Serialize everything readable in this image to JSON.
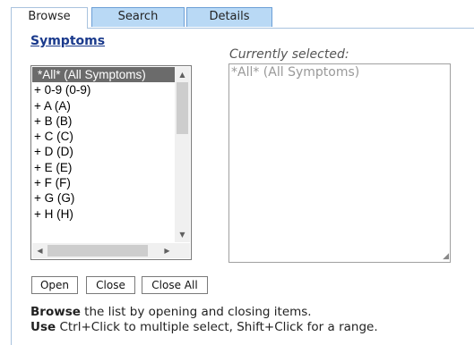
{
  "tabs": [
    {
      "label": "Browse"
    },
    {
      "label": "Search"
    },
    {
      "label": "Details"
    }
  ],
  "symptoms_link": "Symptoms",
  "list": {
    "items": [
      "*All*  (All Symptoms)",
      "+ 0-9  (0-9)",
      "+ A  (A)",
      "+ B  (B)",
      "+ C  (C)",
      "+ D  (D)",
      "+ E  (E)",
      "+ F  (F)",
      "+ G  (G)",
      "+ H  (H)"
    ]
  },
  "selected": {
    "label": "Currently selected:",
    "value": "*All* (All Symptoms)"
  },
  "buttons": {
    "open": "Open",
    "close": "Close",
    "close_all": "Close All"
  },
  "help": {
    "line1_bold": "Browse",
    "line1_rest": " the list by opening and closing items.",
    "line2_bold": "Use",
    "line2_rest": " Ctrl+Click to multiple select, Shift+Click for a range."
  }
}
